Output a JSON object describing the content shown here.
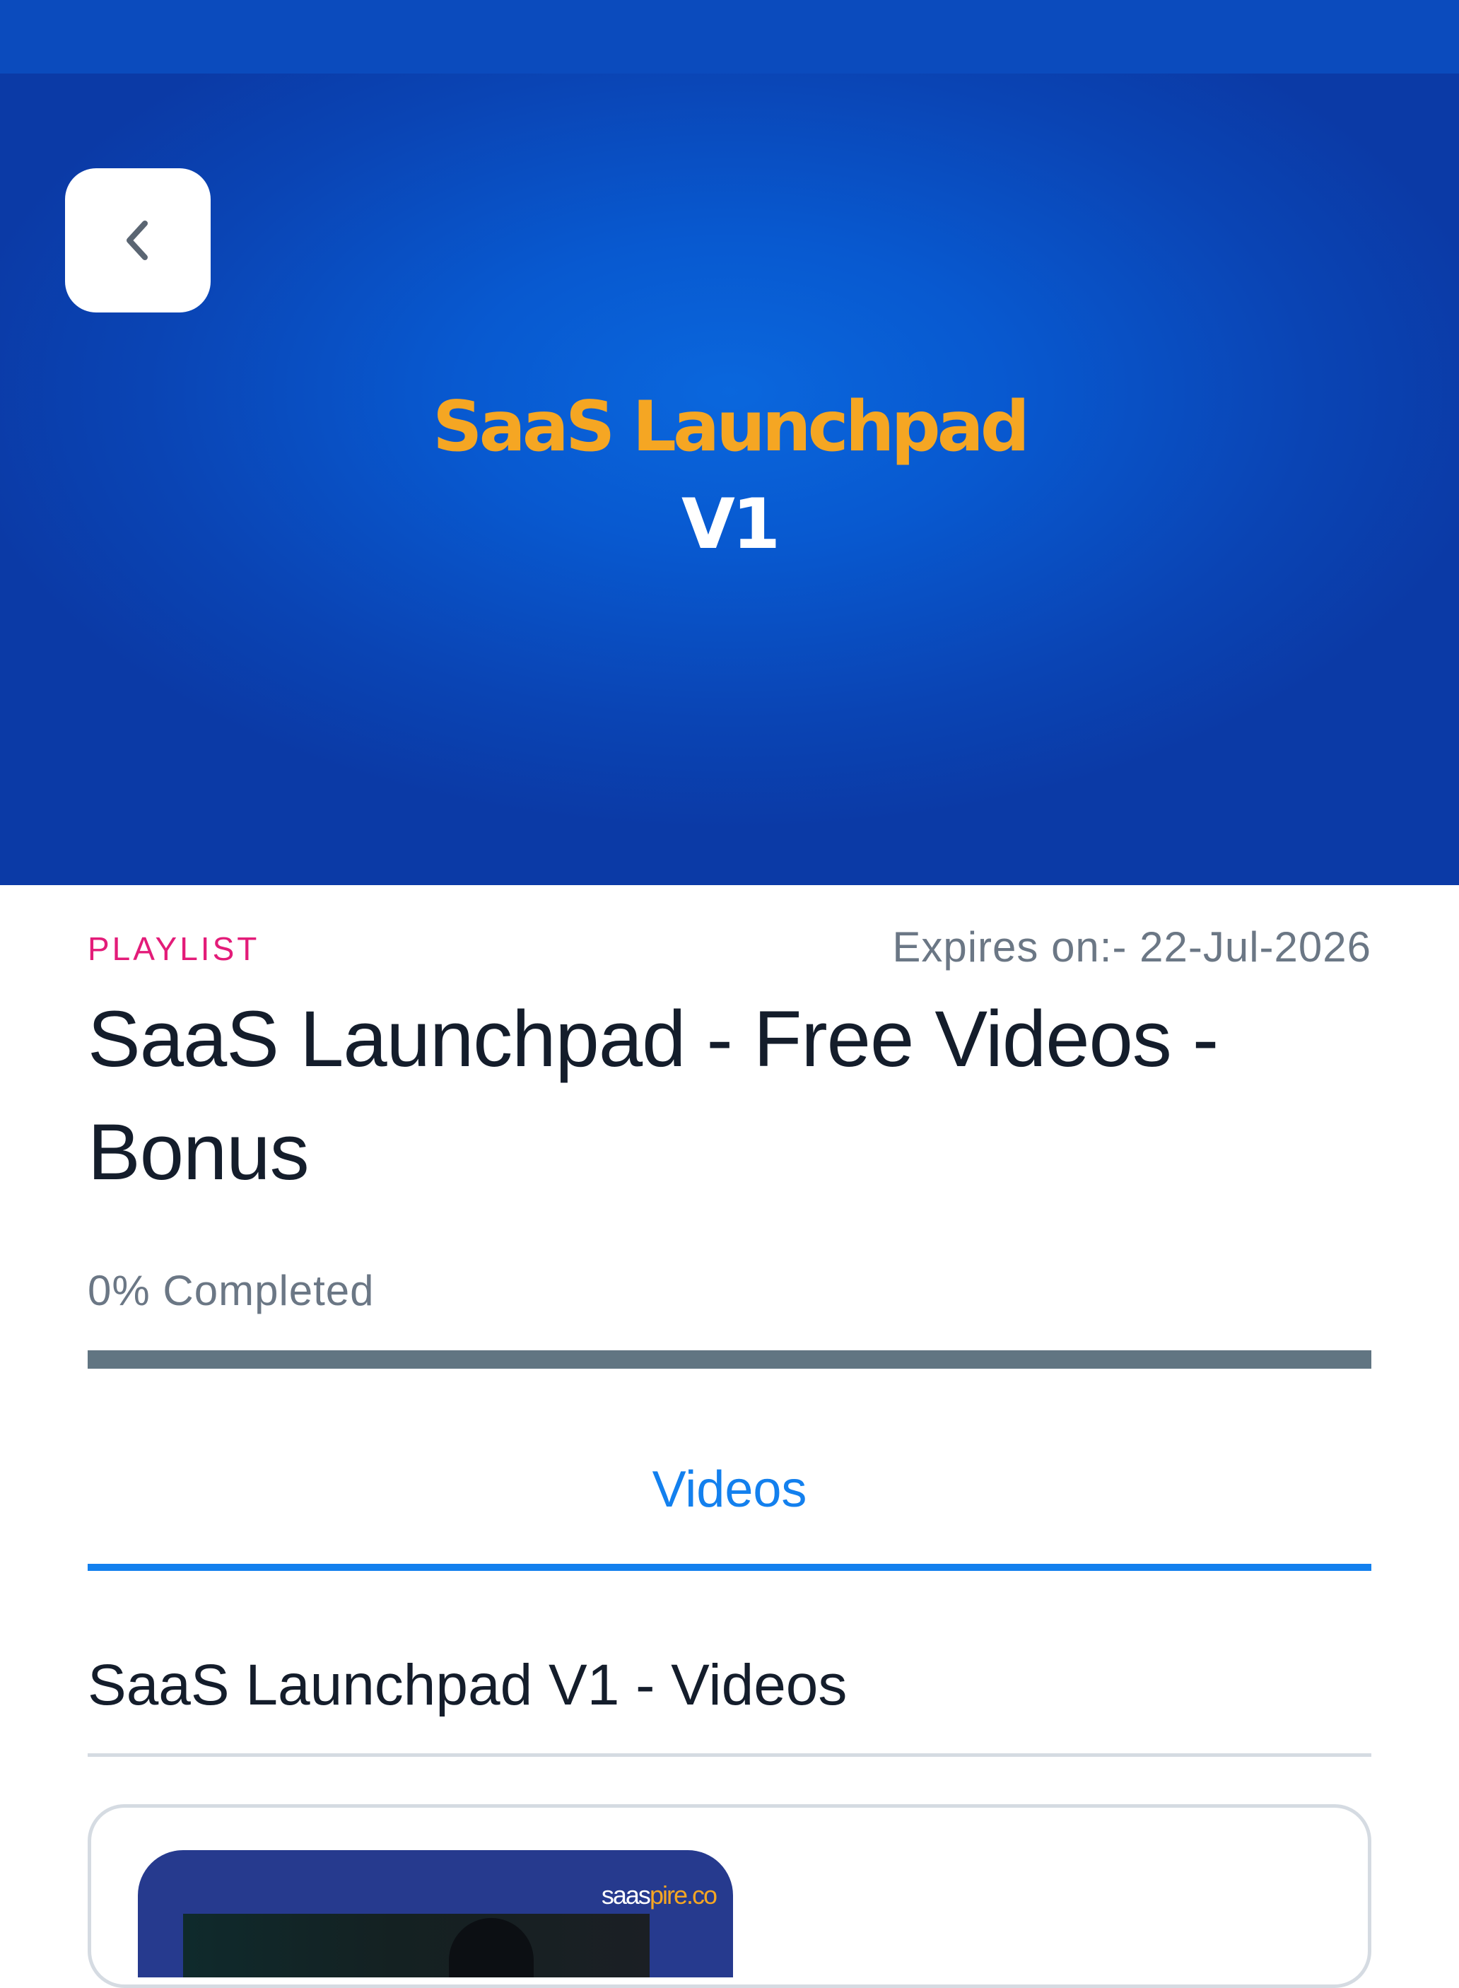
{
  "hero": {
    "title": "SaaS Launchpad",
    "subtitle": "V1"
  },
  "header": {
    "back_icon": "chevron-left-icon"
  },
  "playlist": {
    "tag": "PLAYLIST",
    "expires": "Expires on:- 22-Jul-2026",
    "title": "SaaS Launchpad - Free Videos - Bonus",
    "progress_label": "0% Completed",
    "progress_percent": 0
  },
  "tabs": [
    {
      "label": "Videos",
      "active": true
    }
  ],
  "section": {
    "title": "SaaS Launchpad V1 - Videos"
  },
  "video_card": {
    "brand_prefix": "saas",
    "brand_suffix": "pire.co"
  },
  "colors": {
    "accent": "#1380ee",
    "tag": "#e31c79",
    "hero_title": "#f5a623",
    "hero_bg": "#0a55cc",
    "progress_track": "#617582"
  }
}
